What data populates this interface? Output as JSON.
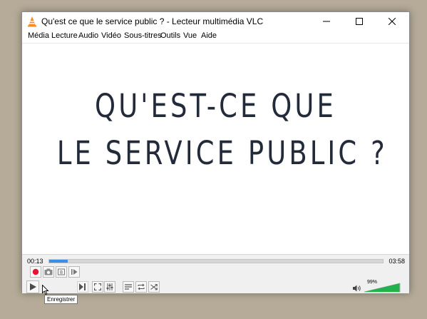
{
  "window": {
    "title": "Qu'est ce que le service public ? - Lecteur multimédia VLC"
  },
  "menu": [
    "Média",
    "Lecture",
    "Audio",
    "Vidéo",
    "Sous-titres",
    "Outils",
    "Vue",
    "Aide"
  ],
  "video": {
    "line1": "QU'EST-CE QUE",
    "line2": "LE SERVICE PUBLIC ?"
  },
  "playback": {
    "elapsed": "00:13",
    "total": "03:58",
    "progress_fraction": 0.055
  },
  "tooltip": "Enregistrer",
  "volume": {
    "label": "99%",
    "level": 0.99
  },
  "colors": {
    "record": "#e8132f",
    "seek": "#3a8ee6",
    "volume": "#22b14c"
  },
  "icons": [
    "vlc-cone-icon",
    "minimize-icon",
    "maximize-icon",
    "close-icon",
    "record-icon",
    "snapshot-icon",
    "loop-ab-icon",
    "frame-step-icon",
    "play-icon",
    "fullscreen-icon",
    "extended-settings-icon",
    "playlist-icon",
    "loop-icon",
    "shuffle-icon",
    "volume-icon"
  ]
}
